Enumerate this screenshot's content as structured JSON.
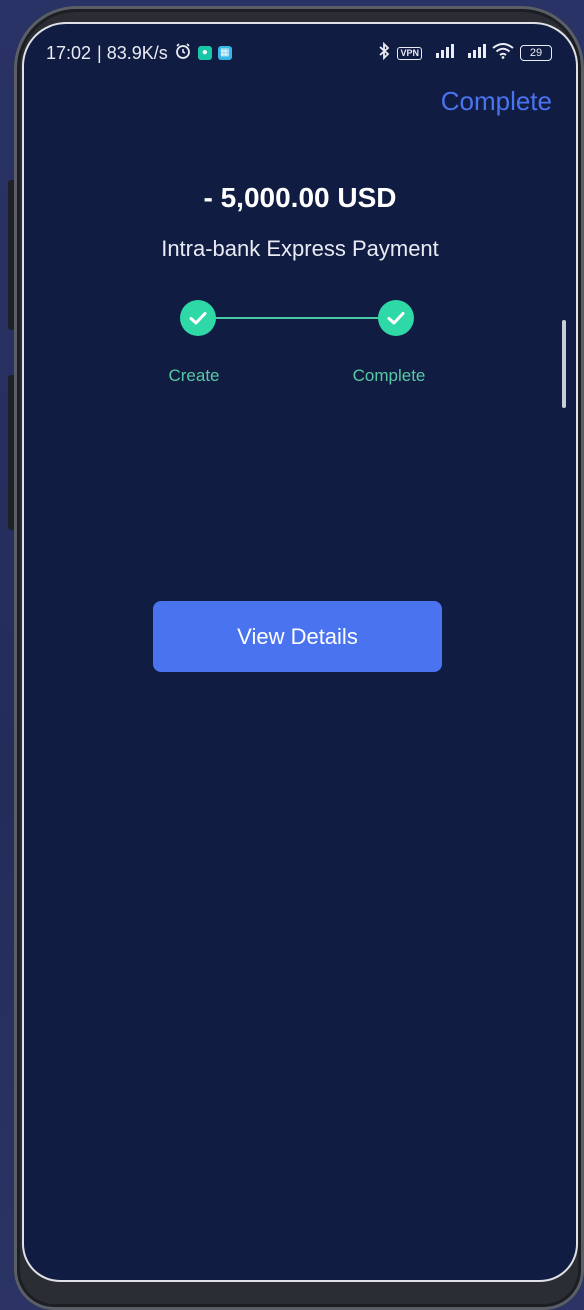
{
  "status_bar": {
    "time": "17:02",
    "net_speed": "| 83.9K/s",
    "alarm_icon": "alarm-icon",
    "vpn": "VPN",
    "battery": "29"
  },
  "header": {
    "complete_link": "Complete"
  },
  "transaction": {
    "amount": "- 5,000.00 USD",
    "type": "Intra-bank Express Payment"
  },
  "progress": {
    "steps": [
      {
        "label": "Create",
        "done": true
      },
      {
        "label": "Complete",
        "done": true
      }
    ]
  },
  "actions": {
    "view_details": "View Details"
  },
  "colors": {
    "screen_bg": "#111c42",
    "accent_blue": "#4a73f0",
    "step_green": "#2ed8a7"
  }
}
